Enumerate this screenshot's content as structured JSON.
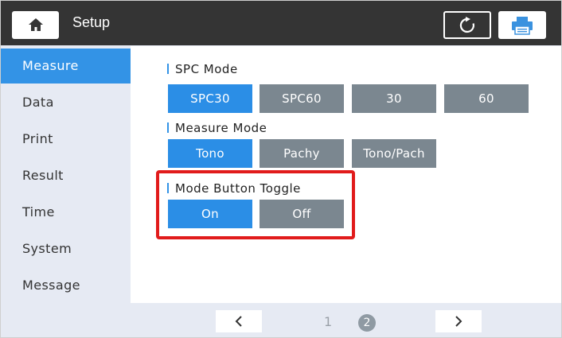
{
  "header": {
    "title": "Setup",
    "home_icon": "home-icon",
    "refresh_icon": "refresh-icon",
    "printer_icon": "printer-icon"
  },
  "sidebar": {
    "items": [
      {
        "label": "Measure",
        "active": true
      },
      {
        "label": "Data",
        "active": false
      },
      {
        "label": "Print",
        "active": false
      },
      {
        "label": "Result",
        "active": false
      },
      {
        "label": "Time",
        "active": false
      },
      {
        "label": "System",
        "active": false
      },
      {
        "label": "Message",
        "active": false
      }
    ]
  },
  "main": {
    "spc_mode": {
      "label": "SPC Mode",
      "options": [
        "SPC30",
        "SPC60",
        "30",
        "60"
      ],
      "selected": "SPC30"
    },
    "measure_mode": {
      "label": "Measure Mode",
      "options": [
        "Tono",
        "Pachy",
        "Tono/Pach"
      ],
      "selected": "Tono"
    },
    "mode_button_toggle": {
      "label": "Mode Button Toggle",
      "options": [
        "On",
        "Off"
      ],
      "selected": "On"
    }
  },
  "pager": {
    "pages": [
      "1",
      "2"
    ],
    "current": "2"
  },
  "colors": {
    "accent": "#2b8ee6",
    "unselected": "#7b8790",
    "header": "#343434",
    "sidebar": "#e6eaf3",
    "highlight": "#e11b1b"
  }
}
